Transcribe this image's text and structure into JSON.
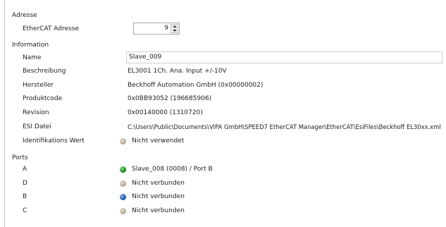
{
  "sections": {
    "adresse": "Adresse",
    "information": "Information",
    "ports": "Ports"
  },
  "adresse": {
    "ethercat_label": "EtherCAT Adresse",
    "ethercat_value": "9"
  },
  "information": {
    "name_label": "Name",
    "name_value": "Slave_009",
    "beschreibung_label": "Beschreibung",
    "beschreibung_value": "EL3001 1Ch. Ana. Input +/-10V",
    "hersteller_label": "Hersteller",
    "hersteller_value": "Beckhoff Automation GmbH (0x00000002)",
    "produktcode_label": "Produktcode",
    "produktcode_value": "0x0BB93052 (196685906)",
    "revision_label": "Revision",
    "revision_value": "0x00140000 (1310720)",
    "esi_label": "ESI Datei",
    "esi_value": "C:\\Users\\Public\\Documents\\VIPA GmbH\\SPEED7 EtherCAT Manager\\EtherCAT\\EsiFiles\\Beckhoff EL30xx.xml",
    "ident_label": "Identifikations Wert",
    "ident_value": "Nicht verwendet",
    "ident_icon": "gray-status-dot-icon"
  },
  "ports": {
    "a_label": "A",
    "a_value": "Slave_008 (0008) / Port B",
    "a_icon": "green-status-dot-icon",
    "d_label": "D",
    "d_value": "Nicht verbunden",
    "d_icon": "gray-status-dot-icon",
    "b_label": "B",
    "b_value": "Nicht verbunden",
    "b_icon": "blue-status-dot-icon",
    "c_label": "C",
    "c_value": "Nicht verbunden",
    "c_icon": "gray-status-dot-icon"
  },
  "colors": {
    "port_connected": "#1f8d1f",
    "port_blue": "#245fb5",
    "port_unused": "#b8ab98"
  }
}
